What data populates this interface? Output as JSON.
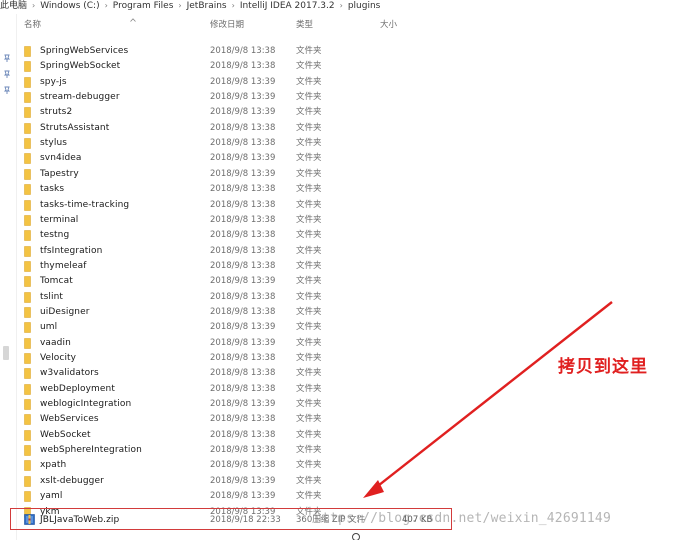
{
  "breadcrumb": {
    "items": [
      "此电脑",
      "Windows (C:)",
      "Program Files",
      "JetBrains",
      "IntelliJ IDEA 2017.3.2",
      "plugins"
    ],
    "separator": "›"
  },
  "columns": {
    "name": "名称",
    "date": "修改日期",
    "type": "类型",
    "size": "大小"
  },
  "folders": [
    {
      "name": "SpringWebServices",
      "date": "2018/9/8 13:38",
      "type": "文件夹"
    },
    {
      "name": "SpringWebSocket",
      "date": "2018/9/8 13:38",
      "type": "文件夹"
    },
    {
      "name": "spy-js",
      "date": "2018/9/8 13:39",
      "type": "文件夹"
    },
    {
      "name": "stream-debugger",
      "date": "2018/9/8 13:39",
      "type": "文件夹"
    },
    {
      "name": "struts2",
      "date": "2018/9/8 13:39",
      "type": "文件夹"
    },
    {
      "name": "StrutsAssistant",
      "date": "2018/9/8 13:38",
      "type": "文件夹"
    },
    {
      "name": "stylus",
      "date": "2018/9/8 13:38",
      "type": "文件夹"
    },
    {
      "name": "svn4idea",
      "date": "2018/9/8 13:39",
      "type": "文件夹"
    },
    {
      "name": "Tapestry",
      "date": "2018/9/8 13:39",
      "type": "文件夹"
    },
    {
      "name": "tasks",
      "date": "2018/9/8 13:38",
      "type": "文件夹"
    },
    {
      "name": "tasks-time-tracking",
      "date": "2018/9/8 13:38",
      "type": "文件夹"
    },
    {
      "name": "terminal",
      "date": "2018/9/8 13:38",
      "type": "文件夹"
    },
    {
      "name": "testng",
      "date": "2018/9/8 13:38",
      "type": "文件夹"
    },
    {
      "name": "tfsIntegration",
      "date": "2018/9/8 13:38",
      "type": "文件夹"
    },
    {
      "name": "thymeleaf",
      "date": "2018/9/8 13:38",
      "type": "文件夹"
    },
    {
      "name": "Tomcat",
      "date": "2018/9/8 13:39",
      "type": "文件夹"
    },
    {
      "name": "tslint",
      "date": "2018/9/8 13:38",
      "type": "文件夹"
    },
    {
      "name": "uiDesigner",
      "date": "2018/9/8 13:38",
      "type": "文件夹"
    },
    {
      "name": "uml",
      "date": "2018/9/8 13:39",
      "type": "文件夹"
    },
    {
      "name": "vaadin",
      "date": "2018/9/8 13:39",
      "type": "文件夹"
    },
    {
      "name": "Velocity",
      "date": "2018/9/8 13:38",
      "type": "文件夹"
    },
    {
      "name": "w3validators",
      "date": "2018/9/8 13:38",
      "type": "文件夹"
    },
    {
      "name": "webDeployment",
      "date": "2018/9/8 13:38",
      "type": "文件夹"
    },
    {
      "name": "weblogicIntegration",
      "date": "2018/9/8 13:39",
      "type": "文件夹"
    },
    {
      "name": "WebServices",
      "date": "2018/9/8 13:38",
      "type": "文件夹"
    },
    {
      "name": "WebSocket",
      "date": "2018/9/8 13:38",
      "type": "文件夹"
    },
    {
      "name": "webSphereIntegration",
      "date": "2018/9/8 13:38",
      "type": "文件夹"
    },
    {
      "name": "xpath",
      "date": "2018/9/8 13:38",
      "type": "文件夹"
    },
    {
      "name": "xslt-debugger",
      "date": "2018/9/8 13:39",
      "type": "文件夹"
    },
    {
      "name": "yaml",
      "date": "2018/9/8 13:39",
      "type": "文件夹"
    },
    {
      "name": "ykm",
      "date": "2018/9/8 13:39",
      "type": "文件夹"
    }
  ],
  "zip_file": {
    "name": "JBLJavaToWeb.zip",
    "date": "2018/9/18 22:33",
    "type": "360压缩 ZIP 文件",
    "size": "407 KB"
  },
  "annotation": {
    "label": "拷贝到这里",
    "color": "#e02020"
  },
  "watermark": "https://blog.csdn.net/weixin_42691149",
  "colors": {
    "folder": "#f3c343",
    "highlight_border": "#d23b3b",
    "arrow": "#e02020"
  }
}
